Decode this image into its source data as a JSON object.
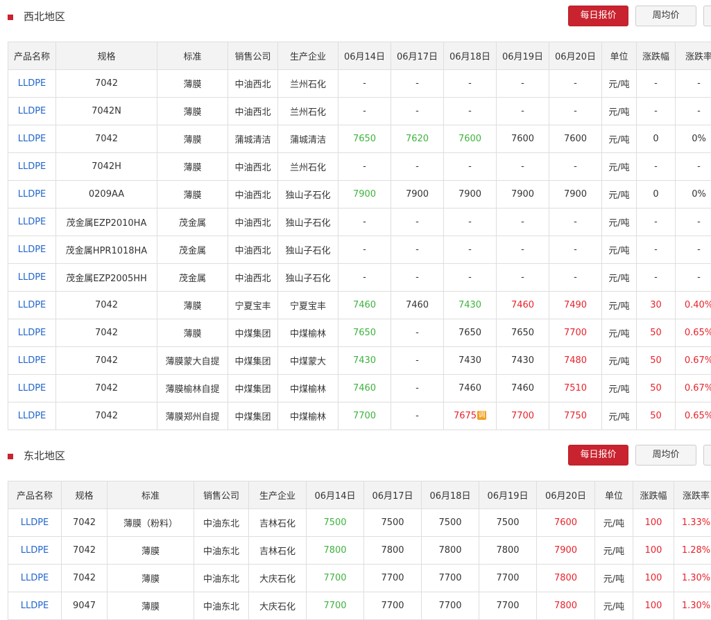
{
  "sections": [
    {
      "title": "西北地区",
      "buttons": {
        "daily": "每日报价",
        "weekly": "周均价"
      },
      "headers": [
        "产品名称",
        "规格",
        "标准",
        "销售公司",
        "生产企业",
        "06月14日",
        "06月17日",
        "06月18日",
        "06月19日",
        "06月20日",
        "单位",
        "涨跌幅",
        "涨跌率"
      ],
      "rows": [
        {
          "cells": [
            "LLDPE",
            "7042",
            "薄膜",
            "中油西北",
            "兰州石化",
            "-",
            "-",
            "-",
            "-",
            "-",
            "元/吨",
            "-",
            "-"
          ],
          "colors": [
            "",
            "",
            "",
            "",
            "",
            "b",
            "b",
            "b",
            "b",
            "b",
            "",
            "b",
            "b"
          ]
        },
        {
          "cells": [
            "LLDPE",
            "7042N",
            "薄膜",
            "中油西北",
            "兰州石化",
            "-",
            "-",
            "-",
            "-",
            "-",
            "元/吨",
            "-",
            "-"
          ],
          "colors": [
            "",
            "",
            "",
            "",
            "",
            "b",
            "b",
            "b",
            "b",
            "b",
            "",
            "b",
            "b"
          ]
        },
        {
          "cells": [
            "LLDPE",
            "7042",
            "薄膜",
            "蒲城清洁",
            "蒲城清洁",
            "7650",
            "7620",
            "7600",
            "7600",
            "7600",
            "元/吨",
            "0",
            "0%"
          ],
          "colors": [
            "",
            "",
            "",
            "",
            "",
            "g",
            "g",
            "g",
            "b",
            "b",
            "",
            "b",
            "b"
          ]
        },
        {
          "cells": [
            "LLDPE",
            "7042H",
            "薄膜",
            "中油西北",
            "兰州石化",
            "-",
            "-",
            "-",
            "-",
            "-",
            "元/吨",
            "-",
            "-"
          ],
          "colors": [
            "",
            "",
            "",
            "",
            "",
            "b",
            "b",
            "b",
            "b",
            "b",
            "",
            "b",
            "b"
          ]
        },
        {
          "cells": [
            "LLDPE",
            "0209AA",
            "薄膜",
            "中油西北",
            "独山子石化",
            "7900",
            "7900",
            "7900",
            "7900",
            "7900",
            "元/吨",
            "0",
            "0%"
          ],
          "colors": [
            "",
            "",
            "",
            "",
            "",
            "g",
            "b",
            "b",
            "b",
            "b",
            "",
            "b",
            "b"
          ]
        },
        {
          "cells": [
            "LLDPE",
            "茂金属EZP2010HA",
            "茂金属",
            "中油西北",
            "独山子石化",
            "-",
            "-",
            "-",
            "-",
            "-",
            "元/吨",
            "-",
            "-"
          ],
          "colors": [
            "",
            "",
            "",
            "",
            "",
            "b",
            "b",
            "b",
            "b",
            "b",
            "",
            "b",
            "b"
          ]
        },
        {
          "cells": [
            "LLDPE",
            "茂金属HPR1018HA",
            "茂金属",
            "中油西北",
            "独山子石化",
            "-",
            "-",
            "-",
            "-",
            "-",
            "元/吨",
            "-",
            "-"
          ],
          "colors": [
            "",
            "",
            "",
            "",
            "",
            "b",
            "b",
            "b",
            "b",
            "b",
            "",
            "b",
            "b"
          ]
        },
        {
          "cells": [
            "LLDPE",
            "茂金属EZP2005HH",
            "茂金属",
            "中油西北",
            "独山子石化",
            "-",
            "-",
            "-",
            "-",
            "-",
            "元/吨",
            "-",
            "-"
          ],
          "colors": [
            "",
            "",
            "",
            "",
            "",
            "b",
            "b",
            "b",
            "b",
            "b",
            "",
            "b",
            "b"
          ]
        },
        {
          "cells": [
            "LLDPE",
            "7042",
            "薄膜",
            "宁夏宝丰",
            "宁夏宝丰",
            "7460",
            "7460",
            "7430",
            "7460",
            "7490",
            "元/吨",
            "30",
            "0.40%"
          ],
          "colors": [
            "",
            "",
            "",
            "",
            "",
            "g",
            "b",
            "g",
            "r",
            "r",
            "",
            "r",
            "r"
          ]
        },
        {
          "cells": [
            "LLDPE",
            "7042",
            "薄膜",
            "中煤集团",
            "中煤榆林",
            "7650",
            "-",
            "7650",
            "7650",
            "7700",
            "元/吨",
            "50",
            "0.65%"
          ],
          "colors": [
            "",
            "",
            "",
            "",
            "",
            "g",
            "b",
            "b",
            "b",
            "r",
            "",
            "r",
            "r"
          ]
        },
        {
          "cells": [
            "LLDPE",
            "7042",
            "薄膜蒙大自提",
            "中煤集团",
            "中煤蒙大",
            "7430",
            "-",
            "7430",
            "7430",
            "7480",
            "元/吨",
            "50",
            "0.67%"
          ],
          "colors": [
            "",
            "",
            "",
            "",
            "",
            "g",
            "b",
            "b",
            "b",
            "r",
            "",
            "r",
            "r"
          ]
        },
        {
          "cells": [
            "LLDPE",
            "7042",
            "薄膜榆林自提",
            "中煤集团",
            "中煤榆林",
            "7460",
            "-",
            "7460",
            "7460",
            "7510",
            "元/吨",
            "50",
            "0.67%"
          ],
          "colors": [
            "",
            "",
            "",
            "",
            "",
            "g",
            "b",
            "b",
            "b",
            "r",
            "",
            "r",
            "r"
          ]
        },
        {
          "cells": [
            "LLDPE",
            "7042",
            "薄膜郑州自提",
            "中煤集团",
            "中煤榆林",
            "7700",
            "-",
            "7675",
            "7700",
            "7750",
            "元/吨",
            "50",
            "0.65%"
          ],
          "colors": [
            "",
            "",
            "",
            "",
            "",
            "g",
            "b",
            "r",
            "r",
            "r",
            "",
            "r",
            "r"
          ],
          "badge_col": 7,
          "badge": "调"
        }
      ]
    },
    {
      "title": "东北地区",
      "buttons": {
        "daily": "每日报价",
        "weekly": "周均价"
      },
      "headers": [
        "产品名称",
        "规格",
        "标准",
        "销售公司",
        "生产企业",
        "06月14日",
        "06月17日",
        "06月18日",
        "06月19日",
        "06月20日",
        "单位",
        "涨跌幅",
        "涨跌率"
      ],
      "rows": [
        {
          "cells": [
            "LLDPE",
            "7042",
            "薄膜（粉料）",
            "中油东北",
            "吉林石化",
            "7500",
            "7500",
            "7500",
            "7500",
            "7600",
            "元/吨",
            "100",
            "1.33%"
          ],
          "colors": [
            "",
            "",
            "",
            "",
            "",
            "g",
            "b",
            "b",
            "b",
            "r",
            "",
            "r",
            "r"
          ]
        },
        {
          "cells": [
            "LLDPE",
            "7042",
            "薄膜",
            "中油东北",
            "吉林石化",
            "7800",
            "7800",
            "7800",
            "7800",
            "7900",
            "元/吨",
            "100",
            "1.28%"
          ],
          "colors": [
            "",
            "",
            "",
            "",
            "",
            "g",
            "b",
            "b",
            "b",
            "r",
            "",
            "r",
            "r"
          ]
        },
        {
          "cells": [
            "LLDPE",
            "7042",
            "薄膜",
            "中油东北",
            "大庆石化",
            "7700",
            "7700",
            "7700",
            "7700",
            "7800",
            "元/吨",
            "100",
            "1.30%"
          ],
          "colors": [
            "",
            "",
            "",
            "",
            "",
            "g",
            "b",
            "b",
            "b",
            "r",
            "",
            "r",
            "r"
          ]
        },
        {
          "cells": [
            "LLDPE",
            "9047",
            "薄膜",
            "中油东北",
            "大庆石化",
            "7700",
            "7700",
            "7700",
            "7700",
            "7800",
            "元/吨",
            "100",
            "1.30%"
          ],
          "colors": [
            "",
            "",
            "",
            "",
            "",
            "g",
            "b",
            "b",
            "b",
            "r",
            "",
            "r",
            "r"
          ]
        }
      ]
    }
  ],
  "colors": {
    "accent": "#c9232f",
    "link": "#2266cc",
    "up": "#e8222a",
    "down": "#3cb33c"
  }
}
